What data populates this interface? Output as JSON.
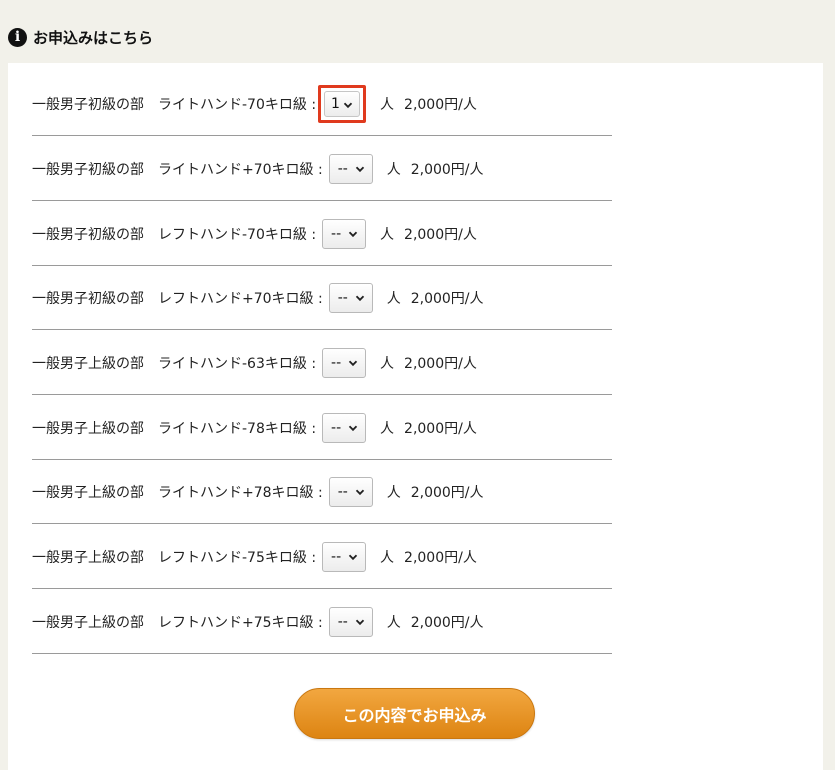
{
  "section": {
    "title": "お申込みはこちら",
    "icon": "info-icon"
  },
  "rows": [
    {
      "category": "一般男子初級の部",
      "class": "ライトハンド-70キロ級 :",
      "selected": "1",
      "unit": "人",
      "price": "2,000円/人"
    },
    {
      "category": "一般男子初級の部",
      "class": "ライトハンド+70キロ級 :",
      "selected": "--",
      "unit": "人",
      "price": "2,000円/人"
    },
    {
      "category": "一般男子初級の部",
      "class": "レフトハンド-70キロ級 :",
      "selected": "--",
      "unit": "人",
      "price": "2,000円/人"
    },
    {
      "category": "一般男子初級の部",
      "class": "レフトハンド+70キロ級 :",
      "selected": "--",
      "unit": "人",
      "price": "2,000円/人"
    },
    {
      "category": "一般男子上級の部",
      "class": "ライトハンド-63キロ級 :",
      "selected": "--",
      "unit": "人",
      "price": "2,000円/人"
    },
    {
      "category": "一般男子上級の部",
      "class": "ライトハンド-78キロ級 :",
      "selected": "--",
      "unit": "人",
      "price": "2,000円/人"
    },
    {
      "category": "一般男子上級の部",
      "class": "ライトハンド+78キロ級 :",
      "selected": "--",
      "unit": "人",
      "price": "2,000円/人"
    },
    {
      "category": "一般男子上級の部",
      "class": "レフトハンド-75キロ級 :",
      "selected": "--",
      "unit": "人",
      "price": "2,000円/人"
    },
    {
      "category": "一般男子上級の部",
      "class": "レフトハンド+75キロ級 :",
      "selected": "--",
      "unit": "人",
      "price": "2,000円/人"
    }
  ],
  "submit": {
    "label": "この内容でお申込み"
  },
  "colors": {
    "highlight": "#e03a1e",
    "button": "#e8951f",
    "background": "#f2f1ea"
  }
}
